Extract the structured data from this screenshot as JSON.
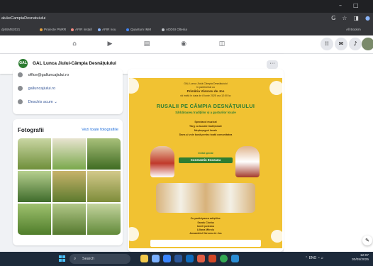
{
  "browser": {
    "url": "alukeCampiaDesnatuiului",
    "bookmarks": [
      {
        "label": "dyISMS2021",
        "color": "#9aa0a6"
      },
      {
        "label": "Proiecte PNRR",
        "color": "#e8a33d"
      },
      {
        "label": "AFIR install",
        "color": "#f28b82"
      },
      {
        "label": "AFIR nou",
        "color": "#8ab4f8"
      },
      {
        "label": "Quantum IMM",
        "color": "#4285f4"
      },
      {
        "label": "ADDSI Oltenia",
        "color": "#bdc1c6"
      },
      {
        "label": "All Bookm",
        "color": "#9aa0a6"
      }
    ],
    "window_controls": [
      "–",
      "□"
    ]
  },
  "page": {
    "name": "GAL Lunca Jiului-Câmpia Desnățuiului",
    "logo_text": "GAL",
    "more_label": "···"
  },
  "intro": {
    "email": "office@galluncajiului.ro",
    "website": "galluncajiului.ro",
    "status": "Deschis acum",
    "status_suffix": "⌄"
  },
  "photos": {
    "title": "Fotografii",
    "see_all": "Vezi toate fotografiile",
    "tiles": [
      {
        "color_top": "#c9d6a3",
        "color_bottom": "#6f8f3a"
      },
      {
        "color_top": "#e8e4d0",
        "color_bottom": "#7aa84b"
      },
      {
        "color_top": "#a8c07a",
        "color_bottom": "#3f6b22"
      },
      {
        "color_top": "#b6cf8e",
        "color_bottom": "#3e6b2b"
      },
      {
        "color_top": "#c7b36a",
        "color_bottom": "#5c7a2e"
      },
      {
        "color_top": "#d3c98a",
        "color_bottom": "#7d8c3a"
      },
      {
        "color_top": "#9fc16f",
        "color_bottom": "#4f7d2a"
      },
      {
        "color_top": "#b2c888",
        "color_bottom": "#55792f"
      },
      {
        "color_top": "#c4d49e",
        "color_bottom": "#628a3a"
      }
    ]
  },
  "poster": {
    "org_line": "GAL Lunca Jiului-Câmpia Desnățuiului",
    "partner_line": "în parteneriat cu",
    "host": "Primăria Vârvoru de Jos",
    "date_line": "vă invită în data de 8 iunie 2025 ora 12:00 la:",
    "title": "RUSALII PE CÂMPIA DESNĂȚUIULUI",
    "subtitle": "Sărbătoarea tradițiilor și a gusturilor locale",
    "items": [
      "Spectacol muzical",
      "Târg cu bucate tradiționale",
      "Meșteșuguri locale",
      "Dans și voie bună pentru toată comunitatea"
    ],
    "invited_label": "Invitat special",
    "guest": "Constantin Enceanu",
    "also_label": "Cu participarea artiștilor:",
    "artists": [
      "Sandu Ciorba",
      "Ionel Ipoteanu",
      "Liliana Mitroiu",
      "Ansamblul Vârvoru de Jos"
    ]
  },
  "taskbar": {
    "search_label": "Search",
    "tray_lang": "ENG",
    "time": "12:07",
    "date": "30/05/2025",
    "apps": [
      {
        "name": "file-explorer",
        "color": "#f2c94c"
      },
      {
        "name": "settings",
        "color": "#7ab0ff"
      },
      {
        "name": "store",
        "color": "#3a86ff"
      },
      {
        "name": "word",
        "color": "#2b579a"
      },
      {
        "name": "outlook",
        "color": "#0f6cbd"
      },
      {
        "name": "photos",
        "color": "#e05d44"
      },
      {
        "name": "powerpoint",
        "color": "#d24726"
      },
      {
        "name": "chrome",
        "color": "#34a853"
      },
      {
        "name": "edge",
        "color": "#2a8dd4"
      }
    ]
  },
  "colors": {
    "fb_blue": "#216fdb",
    "poster_yellow": "#f1c232",
    "poster_green": "#2e7d32"
  }
}
